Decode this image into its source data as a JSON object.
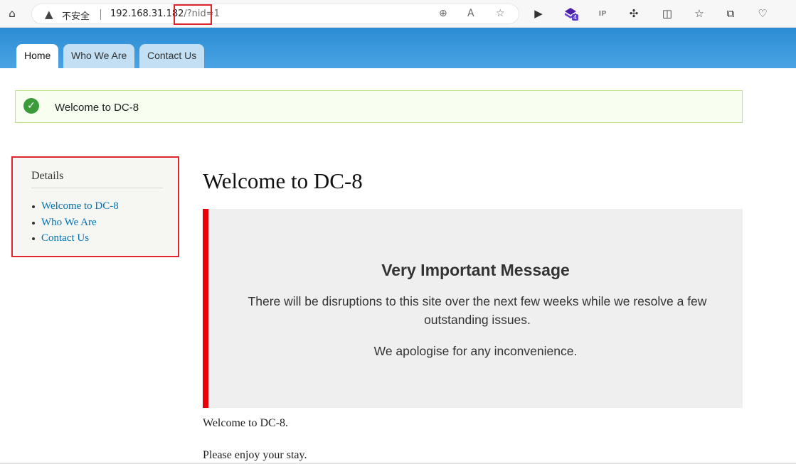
{
  "browser": {
    "security_label": "不安全",
    "url_host": "192.168.31.182",
    "url_path": "/?nid=1",
    "extension_badge": "4",
    "ip_label": "IP"
  },
  "nav": {
    "tabs": [
      {
        "label": "Home",
        "active": true
      },
      {
        "label": "Who We Are",
        "active": false
      },
      {
        "label": "Contact Us",
        "active": false
      }
    ]
  },
  "status": {
    "message": "Welcome to DC-8"
  },
  "sidebar": {
    "title": "Details",
    "items": [
      "Welcome to DC-8",
      "Who We Are",
      "Contact Us"
    ]
  },
  "main": {
    "title": "Welcome to DC-8",
    "notice_heading": "Very Important Message",
    "notice_body": "There will be disruptions to this site over the next few weeks while we resolve a few outstanding issues.",
    "notice_apology": "We apologise for any inconvenience.",
    "paragraph1": "Welcome to DC-8.",
    "paragraph2": "Please enjoy your stay."
  },
  "colors": {
    "header_blue": "#2b8cd4",
    "link_blue": "#0071b3",
    "notice_border_red": "#e8000b",
    "highlight_red": "#e0242c",
    "status_green": "#3b9b3b"
  }
}
